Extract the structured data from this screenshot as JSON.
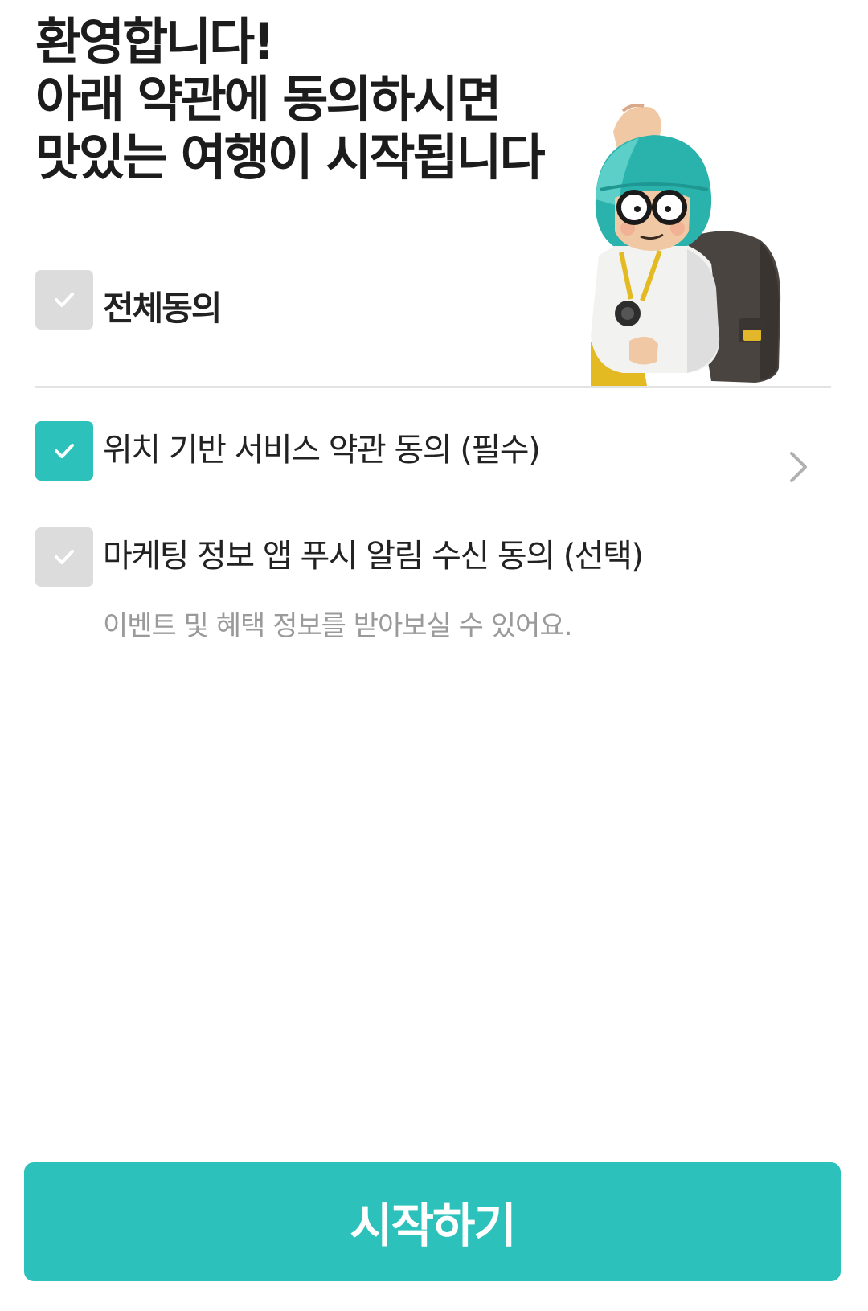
{
  "header": {
    "title_lines": [
      "환영합니다!",
      "아래 약관에 동의하시면",
      "맛있는 여행이 시작됩니다"
    ]
  },
  "agree_all": {
    "label": "전체동의",
    "checked": false
  },
  "terms": [
    {
      "label": "위치 기반 서비스 약관 동의 (필수)",
      "checked": true,
      "has_detail_link": true
    },
    {
      "label": "마케팅 정보 앱 푸시 알림 수신 동의 (선택)",
      "checked": false,
      "description": "이벤트 및 혜택 정보를 받아보실 수 있어요."
    }
  ],
  "start_button": {
    "label": "시작하기"
  },
  "colors": {
    "accent": "#2cc1bb",
    "unchecked": "#dcdcdc",
    "title_text": "#1c1c1c",
    "body_text": "#222222",
    "sub_text": "#9a9a9a",
    "divider": "#e3e3e3"
  },
  "icons": {
    "check": "check-icon",
    "detail": "chevron-right-icon",
    "mascot": "traveler-mascot-illustration"
  }
}
